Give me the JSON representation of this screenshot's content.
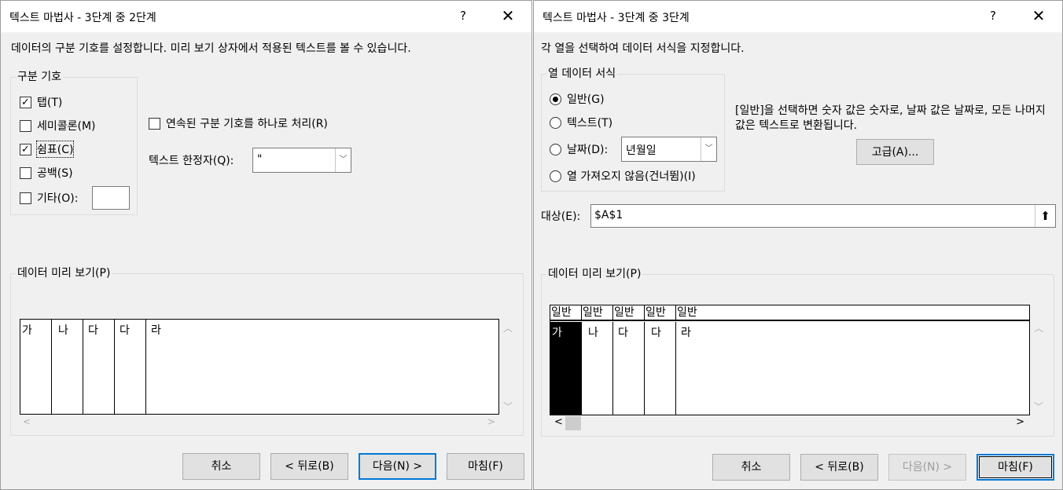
{
  "wizard_step2": {
    "title": "텍스트 마법사 - 3단계 중 2단계",
    "help": "?",
    "close": "✕",
    "description": "데이터의 구분 기호를 설정합니다. 미리 보기 상자에서 적용된 텍스트를 볼 수 있습니다.",
    "delimiters_legend": "구분 기호",
    "tab_label": "탭(T)",
    "tab_checked": true,
    "semicolon_label": "세미콜론(M)",
    "semicolon_checked": false,
    "comma_label": "쉼표(C)",
    "comma_checked": true,
    "space_label": "공백(S)",
    "space_checked": false,
    "other_label": "기타(O):",
    "other_checked": false,
    "other_value": "",
    "consecutive_label": "연속된 구분 기호를 하나로 처리(R)",
    "consecutive_checked": false,
    "qualifier_label": "텍스트 한정자(Q):",
    "qualifier_value": "\"",
    "preview_legend": "데이터 미리 보기(P)",
    "preview_cells": [
      "가",
      "나",
      "다",
      "다",
      "라"
    ],
    "cancel": "취소",
    "back": "< 뒤로(B)",
    "next": "다음(N) >",
    "finish": "마침(F)"
  },
  "wizard_step3": {
    "title": "텍스트 마법사 - 3단계 중 3단계",
    "help": "?",
    "close": "✕",
    "description": "각 열을 선택하여 데이터 서식을 지정합니다.",
    "format_legend": "열 데이터 서식",
    "general_label": "일반(G)",
    "text_label": "텍스트(T)",
    "date_label": "날짜(D):",
    "date_format": "년월일",
    "skip_label": "열 가져오지 않음(건너뜀)(I)",
    "selected_format": "general",
    "info_text": "[일반]을 선택하면 숫자 값은 숫자로, 날짜 값은 날짜로, 모든 나머지 값은 텍스트로 변환됩니다.",
    "advanced": "고급(A)...",
    "destination_label": "대상(E):",
    "destination_value": "$A$1",
    "preview_legend": "데이터 미리 보기(P)",
    "preview_headers": [
      "일반",
      "일반",
      "일반",
      "일반",
      "일반"
    ],
    "preview_cells": [
      "가",
      "나",
      "다",
      "다",
      "라"
    ],
    "cancel": "취소",
    "back": "< 뒤로(B)",
    "next": "다음(N) >",
    "finish": "마침(F)"
  }
}
